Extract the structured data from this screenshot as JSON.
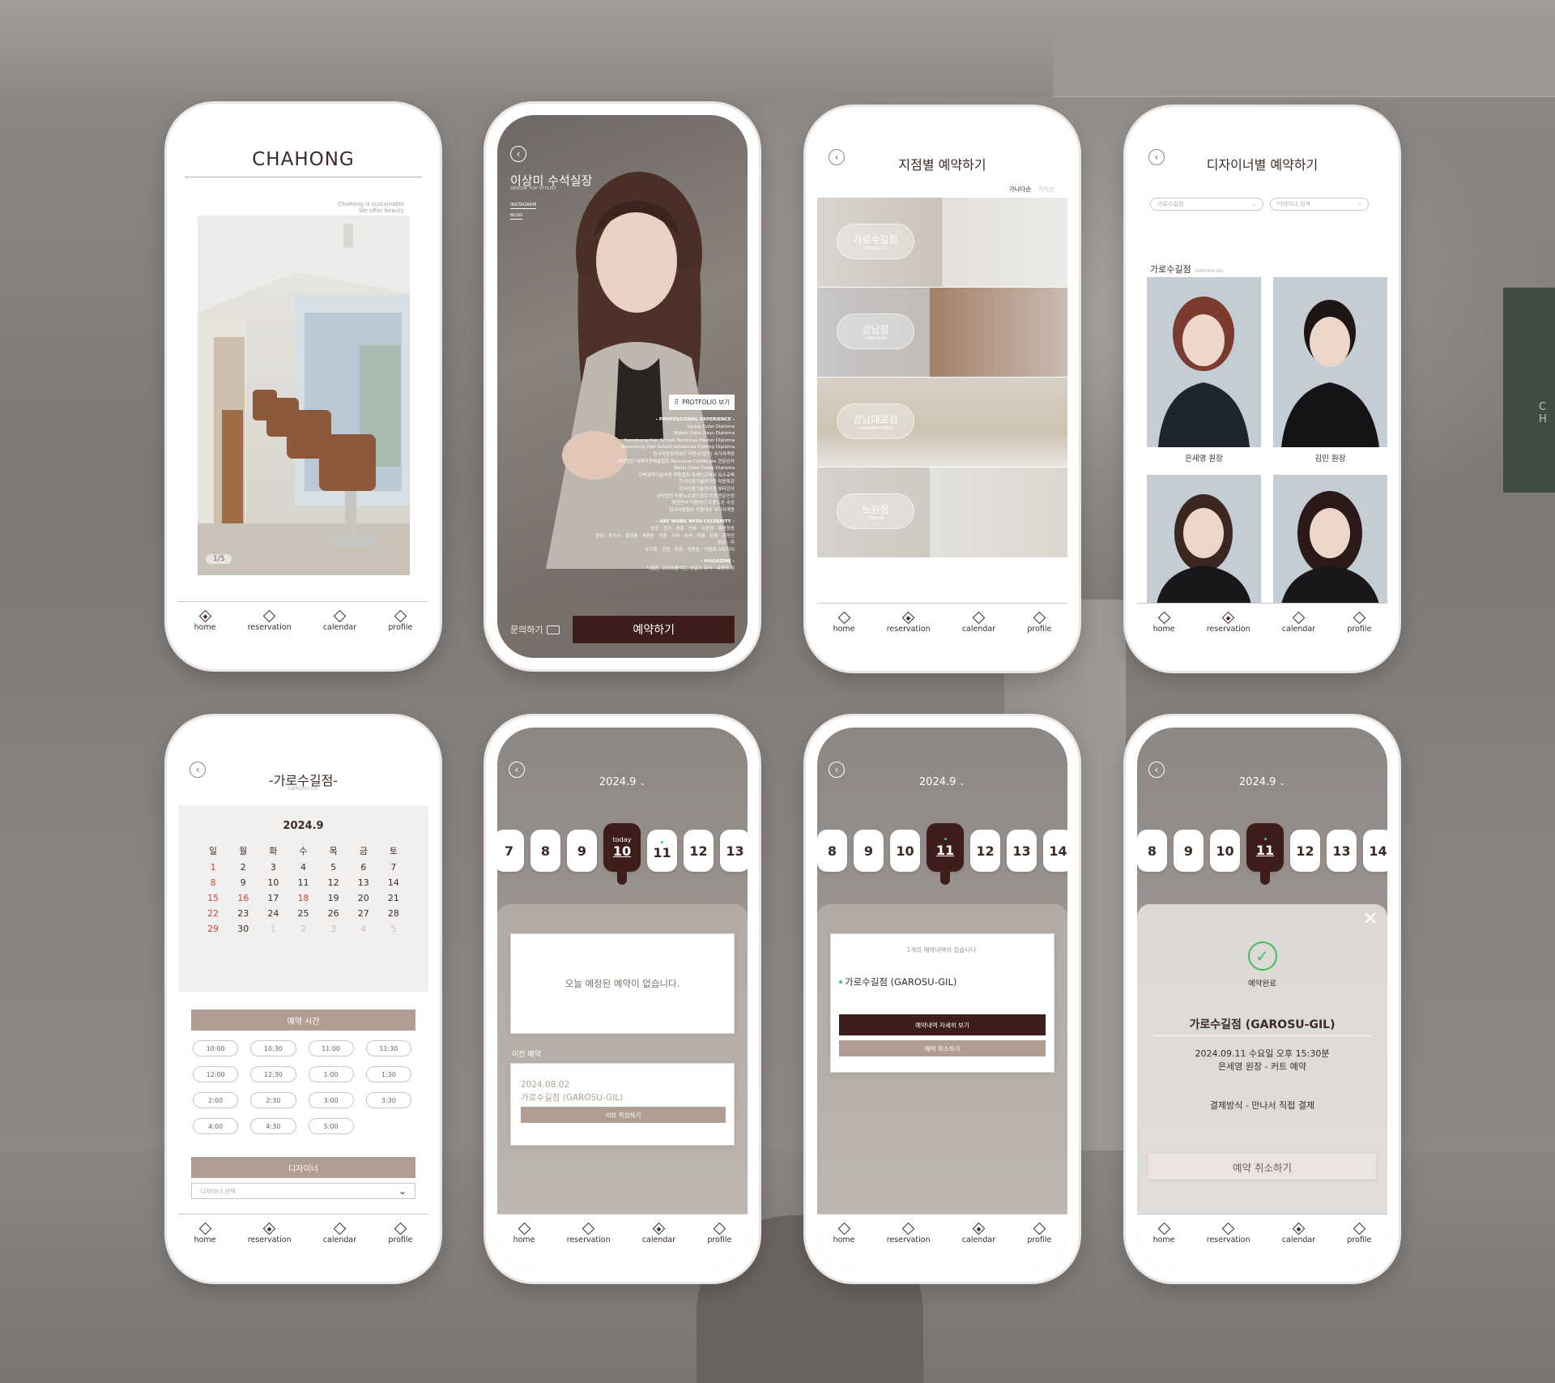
{
  "nav": [
    "home",
    "reservation",
    "calendar",
    "profile"
  ],
  "p1": {
    "brand": "CHAHONG",
    "tagline1": "Chahong is sustainable",
    "tagline2": "We offer beauty",
    "counter": "1/5"
  },
  "p2": {
    "name": "이상미 수석실장",
    "name_en": "SENIOR TOP STYLIST",
    "link1": "INSTAGRAM",
    "link2": "BLOG",
    "portfolio": "PROTFOLIO 보기",
    "sec1": "- PROFESSIONAL EXPERIENCE -",
    "exp": [
      "Loreal Color Diploma",
      "Milbon Color Days Diploma",
      "Kwonhong Hair School Technical Master Diploma",
      "Kwonhong Hair School Advanced Cutting Diploma",
      "한국미용장학재단 미용사(일반) 국가자격증",
      "사단법인 세계미용예술협회 Technical Certificate 전문강사",
      "Wella Color Camp Diploma",
      "강북권역기술부장 미용협회 장애인교육사 보수교육",
      "한국미용기술연구원 미용특강",
      "한국미용기술연구원 뷰티강사",
      "사단법인 미용뉴트렌드협회 미용전문인정",
      "대한민국 미용대상 트렌드상 수상",
      "한국미용협회 미용대상 국가자격증"
    ],
    "sec2": "- ART WORK WITH CELEBRITY -",
    "art": [
      "송중 · 현거 · 경훈 · 민호 · 이정현 · 제원정동",
      "윤승 · 류가시 · 형정혜 · 서원민 · 정원 · 스타 · 유러 · 이왜 · 정원 · 김미인",
      "방문 · 위",
      "유지원 · 정원 · 류원 · 최원정 · 이원화 사조지다"
    ],
    "sec3": "- MAGAZINE -",
    "mag": [
      "나일론, 코스모폴리탄, 싱글즈 유러 · 유원정 외"
    ],
    "inquiry": "문의하기",
    "reserve": "예약하기"
  },
  "p3": {
    "title": "지점별 예약하기",
    "sort1": "가나다순",
    "sort2": "거리순",
    "branches": [
      {
        "ko": "가로수길점",
        "en": "GAROSU-GIL"
      },
      {
        "ko": "강남점",
        "en": "GANGNAM"
      },
      {
        "ko": "강남대로점",
        "en": "GANGNAM-DAERO"
      },
      {
        "ko": "노원점",
        "en": "NOWON"
      }
    ]
  },
  "p4": {
    "title": "디자이너별 예약하기",
    "select": "가로수길점",
    "search_ph": "디자이너 검색",
    "branch": "가로수길점",
    "branch_en": "GAROSU-GIL",
    "designers": [
      "은세영 원장",
      "김민 원장",
      "",
      ""
    ]
  },
  "p5": {
    "title": "-가로수길점-",
    "title_en": "GAROSU-GIL",
    "month": "2024.9",
    "weekdays": [
      "일",
      "월",
      "화",
      "수",
      "목",
      "금",
      "토"
    ],
    "weeks": [
      [
        "1",
        "2",
        "3",
        "4",
        "5",
        "6",
        "7"
      ],
      [
        "8",
        "9",
        "10",
        "11",
        "12",
        "13",
        "14"
      ],
      [
        "15",
        "16",
        "17",
        "18",
        "19",
        "20",
        "21"
      ],
      [
        "22",
        "23",
        "24",
        "25",
        "26",
        "27",
        "28"
      ],
      [
        "29",
        "30",
        "1",
        "2",
        "3",
        "4",
        "5"
      ]
    ],
    "time_head": "예약 시간",
    "times": [
      "10:00",
      "10:30",
      "11:00",
      "11:30",
      "12:00",
      "12:30",
      "1:00",
      "1:30",
      "2:00",
      "2:30",
      "3:00",
      "3:30",
      "4:00",
      "4:30",
      "5:00"
    ],
    "designer_head": "디자이너",
    "designer_ph": "디자이너 선택"
  },
  "p6": {
    "month": "2024.9",
    "dates": [
      "7",
      "8",
      "9",
      "10",
      "11",
      "12",
      "13"
    ],
    "today": "today",
    "empty": "오늘 예정된 예약이 없습니다.",
    "prev_label": "이전 예약",
    "prev_date": "2024.08.02",
    "prev_branch": "가로수길점 (GAROSU-GIL)",
    "review": "리뷰 작성하기"
  },
  "p7": {
    "month": "2024.9",
    "dates": [
      "8",
      "9",
      "10",
      "11",
      "12",
      "13",
      "14"
    ],
    "count": "1개의 예약내역이 있습니다.",
    "branch": "가로수길점 (GAROSU-GIL)",
    "detail": "예약내역 자세히 보기",
    "cancel": "예약 취소하기"
  },
  "p8": {
    "month": "2024.9",
    "dates": [
      "8",
      "9",
      "10",
      "11",
      "12",
      "13",
      "14"
    ],
    "done": "예약완료",
    "branch": "가로수길점 (GAROSU-GIL)",
    "line1": "2024.09.11 수요일 오후 15:30분",
    "line2": "은세영 원장 - 커트 예약",
    "pay": "결제방식 - 만나서 직접 결제",
    "cancel": "예약 취소하기"
  }
}
